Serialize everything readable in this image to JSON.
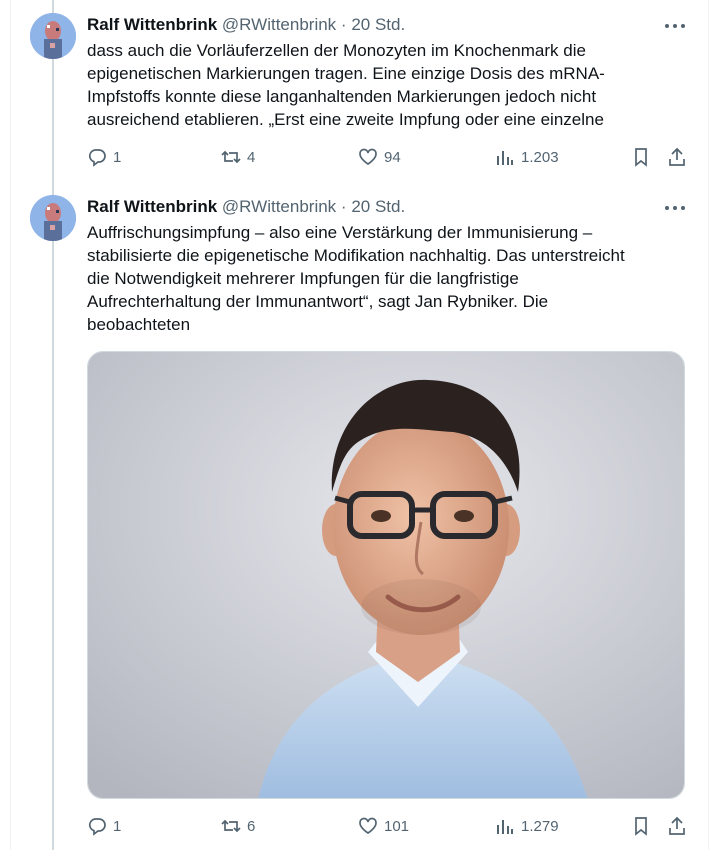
{
  "tweets": [
    {
      "author_name": "Ralf Wittenbrink",
      "author_handle": "@RWittenbrink",
      "separator": "·",
      "time": "20 Std.",
      "text_lines": [
        "dass auch die Vorläuferzellen der Monozyten im Knochenmark die",
        "epigenetischen Markierungen tragen. Eine einzige Dosis des mRNA-",
        "Impfstoffs konnte diese langanhaltenden Markierungen jedoch nicht",
        "ausreichend etablieren. „Erst eine zweite Impfung oder eine einzelne"
      ],
      "replies": "1",
      "reposts": "4",
      "likes": "94",
      "views": "1.203"
    },
    {
      "author_name": "Ralf Wittenbrink",
      "author_handle": "@RWittenbrink",
      "separator": "·",
      "time": "20 Std.",
      "text_lines": [
        "Auffrischungsimpfung – also eine Verstärkung der Immunisierung –",
        "stabilisierte die epigenetische Modifikation nachhaltig. Das unterstreicht",
        "die Notwendigkeit mehrerer Impfungen für die langfristige",
        "Aufrechterhaltung der Immunantwort“, sagt Jan Rybniker. Die",
        "beobachteten"
      ],
      "replies": "1",
      "reposts": "6",
      "likes": "101",
      "views": "1.279"
    }
  ],
  "icons": {
    "more": "more-horizontal-icon",
    "reply": "reply-icon",
    "repost": "repost-icon",
    "like": "heart-icon",
    "views": "views-icon",
    "bookmark": "bookmark-icon",
    "share": "share-icon"
  },
  "colors": {
    "text": "#0f1419",
    "secondary": "#536471",
    "thread_line": "#cfd9de",
    "avatar_bg": "#8fb4e8"
  }
}
